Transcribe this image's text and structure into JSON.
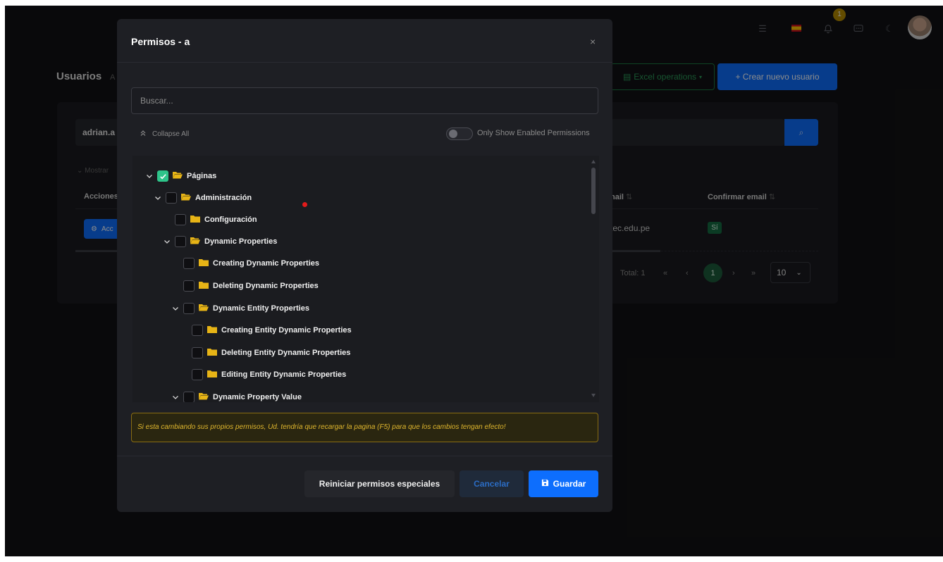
{
  "header": {
    "notifications_count": "1"
  },
  "page": {
    "title": "Usuarios",
    "title_sub": "A",
    "excel_label": "Excel operations",
    "create_label": "+ Crear nuevo usuario",
    "filter_value": "adrian.a",
    "mostrar_label": "Mostrar",
    "table_headers": [
      "Acciones",
      "nail",
      "Confirmar email"
    ],
    "actions_label": "Acc",
    "email_cell": "tec.edu.pe",
    "confirm_badge": "Sí",
    "total_label": "Total: 1",
    "current_page": "1",
    "page_size": "10"
  },
  "modal": {
    "title": "Permisos - a",
    "close_glyph": "×",
    "search_placeholder": "Buscar...",
    "collapse_all_label": "Collapse All",
    "toggle_label": "Only Show Enabled Permissions",
    "tree": [
      {
        "label": "Páginas",
        "checked": true,
        "expanded": true
      },
      {
        "label": "Administración",
        "checked": false,
        "expanded": true
      },
      {
        "label": "Configuración",
        "checked": false,
        "expanded": false
      },
      {
        "label": "Dynamic Properties",
        "checked": false,
        "expanded": true
      },
      {
        "label": "Creating Dynamic Properties",
        "checked": false,
        "expanded": false
      },
      {
        "label": "Deleting Dynamic Properties",
        "checked": false,
        "expanded": false
      },
      {
        "label": "Dynamic Entity Properties",
        "checked": false,
        "expanded": true
      },
      {
        "label": "Creating Entity Dynamic Properties",
        "checked": false,
        "expanded": false
      },
      {
        "label": "Deleting Entity Dynamic Properties",
        "checked": false,
        "expanded": false
      },
      {
        "label": "Editing Entity Dynamic Properties",
        "checked": false,
        "expanded": false
      },
      {
        "label": "Dynamic Property Value",
        "checked": false,
        "expanded": true
      }
    ],
    "warning": "Si esta cambiando sus propios permisos, Ud. tendría que recargar la pagina (F5) para que los cambios tengan efecto!",
    "reset_label": "Reiniciar permisos especiales",
    "cancel_label": "Cancelar",
    "save_label": "Guardar"
  },
  "colors": {
    "accent": "#0d6efd",
    "success": "#2ec48a",
    "folder": "#e7b416",
    "warning": "#e0b72e"
  }
}
